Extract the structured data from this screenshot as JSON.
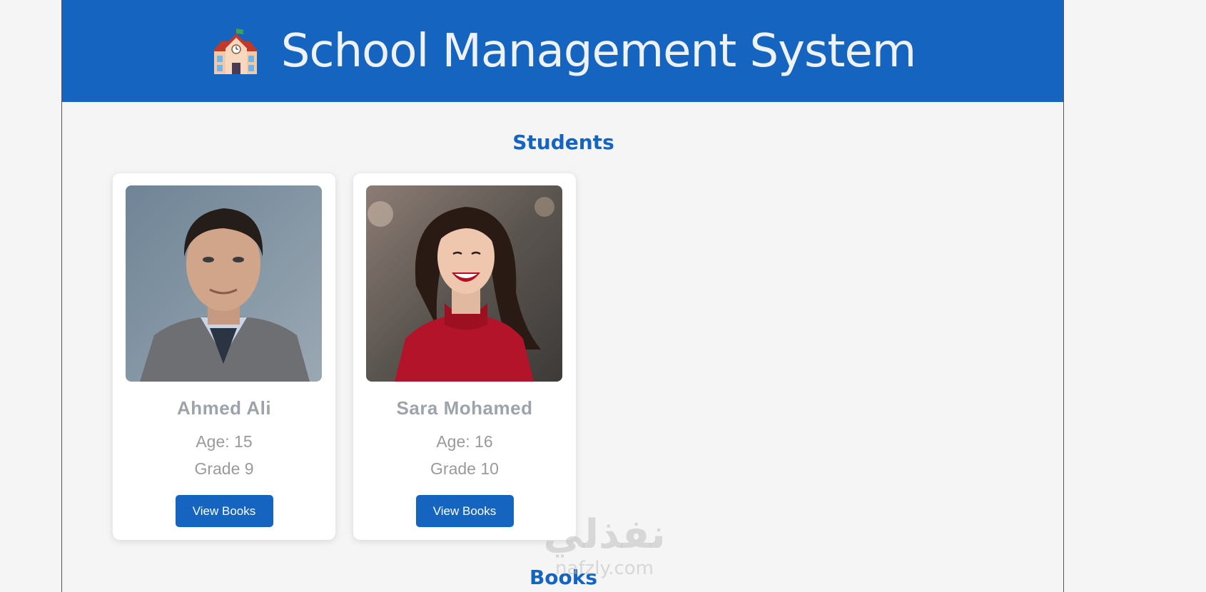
{
  "header": {
    "title": "School Management System",
    "icon": "school-building-icon"
  },
  "students_section": {
    "title": "Students",
    "students": [
      {
        "name": "Ahmed Ali",
        "age": "Age: 15",
        "grade": "Grade 9",
        "button": "View Books",
        "photo": "man-portrait-photo"
      },
      {
        "name": "Sara Mohamed",
        "age": "Age: 16",
        "grade": "Grade 10",
        "button": "View Books",
        "photo": "woman-portrait-photo"
      }
    ]
  },
  "books_section": {
    "title": "Books"
  },
  "watermark": {
    "arabic": "نفذلي",
    "site": "nafzly.com"
  },
  "colors": {
    "primary": "#1565c0",
    "background": "#f5f5f5",
    "card": "#ffffff",
    "muted_text": "#9a9a9a"
  }
}
